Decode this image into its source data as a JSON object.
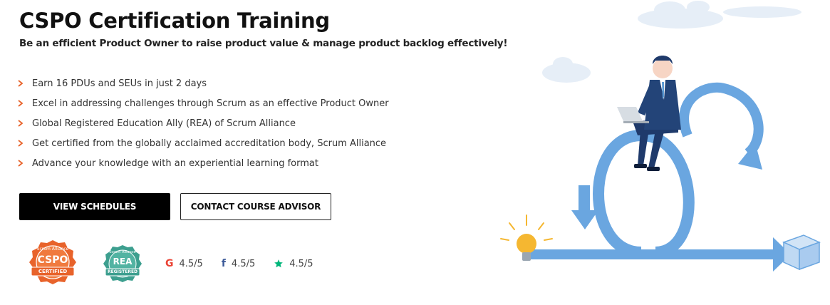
{
  "header": {
    "title": "CSPO Certification Training",
    "subtitle": "Be an efficient Product Owner to raise product value & manage product backlog effectively!"
  },
  "features": [
    "Earn 16 PDUs and SEUs in just 2 days",
    "Excel in addressing challenges through Scrum as an effective Product Owner",
    "Global Registered Education Ally (REA) of Scrum Alliance",
    "Get certified from the globally acclaimed accreditation body, Scrum Alliance",
    "Advance your knowledge with an experiential learning format"
  ],
  "actions": {
    "view_schedules": "VIEW SCHEDULES",
    "contact_advisor": "CONTACT COURSE ADVISOR"
  },
  "badges": {
    "cspo": {
      "top": "Scrum Alliance",
      "main": "CSPO",
      "ribbon": "CERTIFIED"
    },
    "rea": {
      "top": "Scrum Alliance",
      "main": "REA",
      "ribbon": "REGISTERED"
    }
  },
  "ratings": [
    {
      "source": "google-icon",
      "value": "4.5/5",
      "color": "#ea4335"
    },
    {
      "source": "facebook-icon",
      "value": "4.5/5",
      "color": "#3b5998"
    },
    {
      "source": "star-icon",
      "value": "4.5/5",
      "color": "#00b67a"
    }
  ],
  "colors": {
    "accent": "#e8632b",
    "loop_blue": "#5b9bd5",
    "suit": "#1f3a6b",
    "bulb": "#f5b731"
  }
}
